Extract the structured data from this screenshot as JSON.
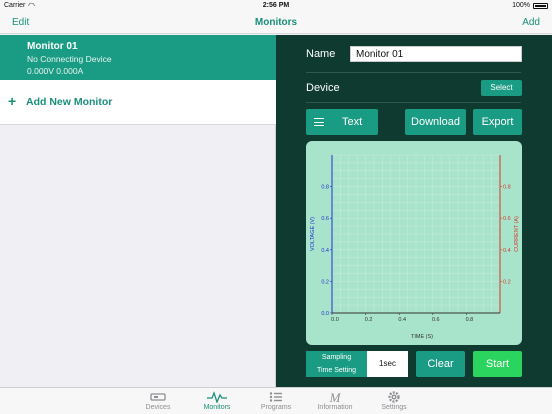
{
  "status_bar": {
    "carrier": "Carrier",
    "time": "2:56 PM",
    "battery": "100%"
  },
  "nav": {
    "left": "Edit",
    "title": "Monitors",
    "right": "Add"
  },
  "monitors": [
    {
      "name": "Monitor 01",
      "status": "No Connecting Device",
      "values": "0.000V 0.000A"
    }
  ],
  "add_monitor": {
    "icon": "+",
    "label": "Add New Monitor"
  },
  "detail": {
    "name_label": "Name",
    "name_value": "Monitor 01",
    "device_label": "Device",
    "select_label": "Select",
    "text_label": "Text",
    "download_label": "Download",
    "export_label": "Export",
    "sampling_line1": "Sampling",
    "sampling_line2": "Time Setting",
    "interval_value": "1sec",
    "clear_label": "Clear",
    "start_label": "Start"
  },
  "chart_data": {
    "type": "line",
    "xlabel": "TIME (S)",
    "ylabel_left": "VOLTAGE (V)",
    "ylabel_right": "CURRENT (A)",
    "x_ticks": [
      "0.0",
      "0.2",
      "0.4",
      "0.6",
      "0.8"
    ],
    "y_left_ticks": [
      "0.0",
      "0.2",
      "0.4",
      "0.6",
      "0.8"
    ],
    "y_right_ticks": [
      "0.2",
      "0.4",
      "0.6",
      "0.8"
    ],
    "xlim": [
      0,
      1
    ],
    "ylim": [
      0,
      1
    ],
    "grid": true,
    "series": [],
    "colors": {
      "voltage": "#2233cc",
      "current": "#d43a2a",
      "grid": "#c9ecdd",
      "axis": "#333333"
    }
  },
  "tabs": [
    {
      "label": "Devices",
      "icon": "devices-icon",
      "active": false
    },
    {
      "label": "Monitors",
      "icon": "monitors-icon",
      "active": true
    },
    {
      "label": "Programs",
      "icon": "programs-icon",
      "active": false
    },
    {
      "label": "Information",
      "icon": "information-icon",
      "active": false
    },
    {
      "label": "Settings",
      "icon": "settings-icon",
      "active": false
    }
  ],
  "colors": {
    "accent": "#1a9b83",
    "panel": "#0f3a30",
    "start": "#2bd45f"
  }
}
